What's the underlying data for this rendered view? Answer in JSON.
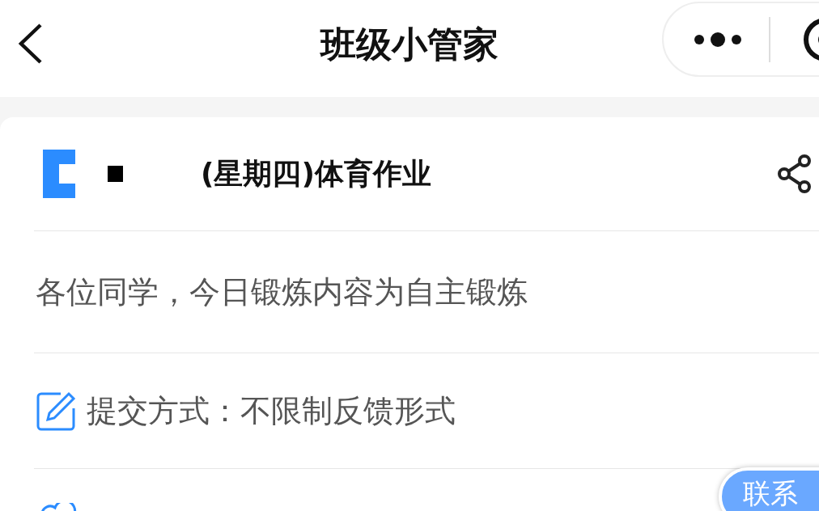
{
  "nav": {
    "title": "班级小管家"
  },
  "homework": {
    "title": "(星期四)体育作业",
    "description": "各位同学，今日锻炼内容为自主锻炼",
    "submission": "提交方式：不限制反馈形式"
  },
  "contact_button": {
    "label": "联系"
  }
}
